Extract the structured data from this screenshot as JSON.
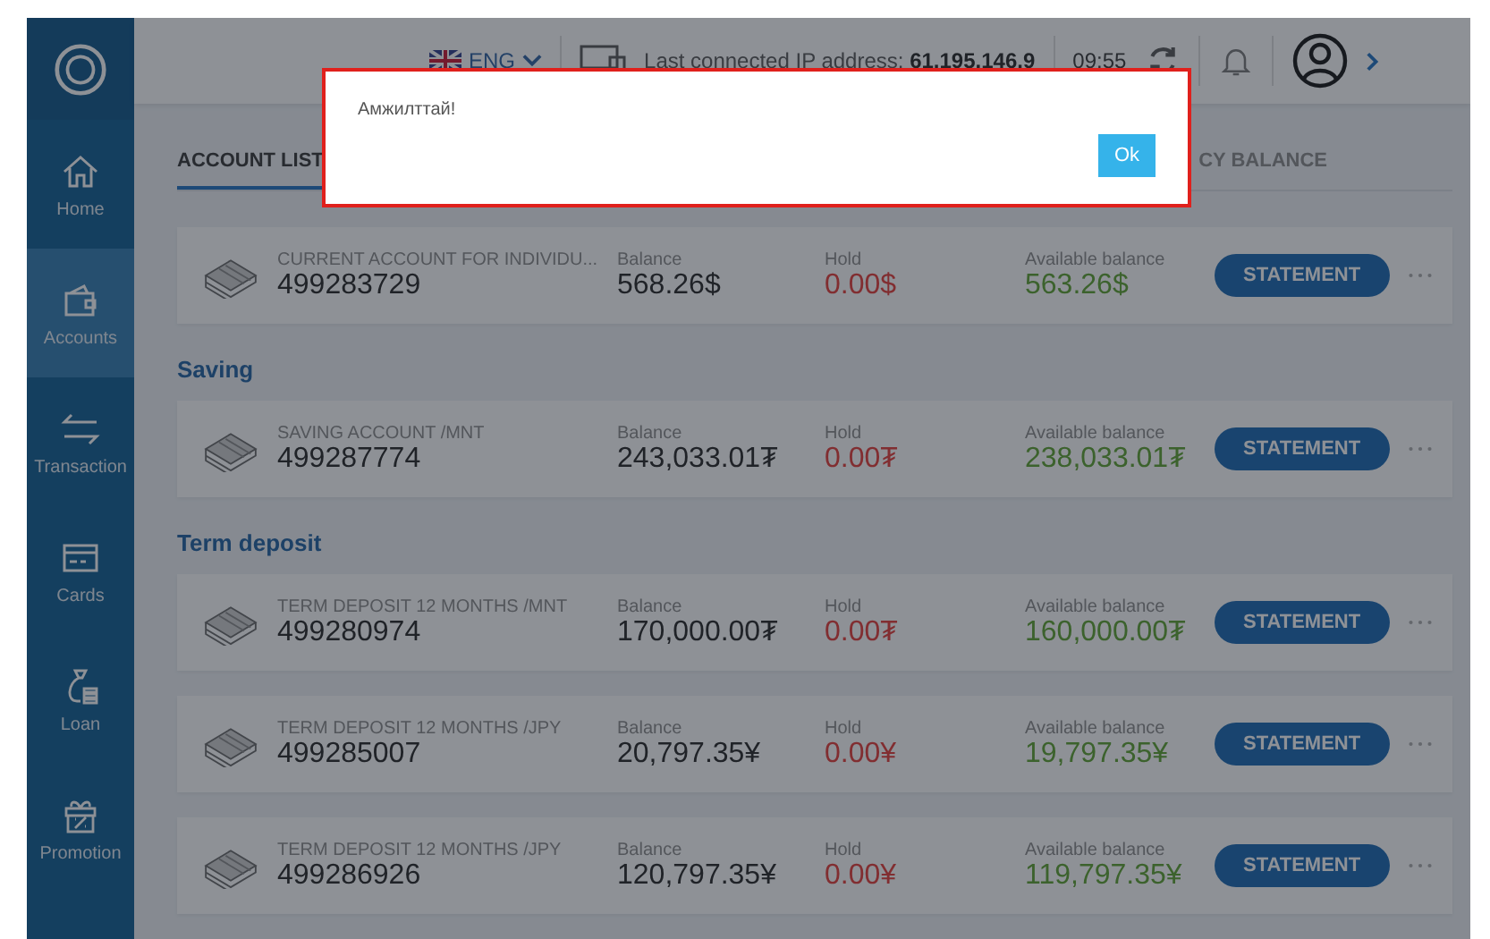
{
  "header": {
    "language": "ENG",
    "ip_label": "Last connected IP address:",
    "ip": "61.195.146.9",
    "time": "09:55"
  },
  "sidebar": {
    "items": [
      {
        "label": "Home",
        "selected": false
      },
      {
        "label": "Accounts",
        "selected": true
      },
      {
        "label": "Transaction",
        "selected": false
      },
      {
        "label": "Cards",
        "selected": false
      },
      {
        "label": "Loan",
        "selected": false
      },
      {
        "label": "Promotion",
        "selected": false
      }
    ]
  },
  "tabs": [
    {
      "label": "ACCOUNT LIST",
      "selected": true
    },
    {
      "label": "CY BALANCE",
      "selected": false
    }
  ],
  "groups": [
    {
      "accounts": [
        {
          "name": "CURRENT ACCOUNT FOR INDIVIDU...",
          "number": "499283729",
          "balance_label": "Balance",
          "balance": "568.26$",
          "hold_label": "Hold",
          "hold": "0.00$",
          "available_label": "Available balance",
          "available": "563.26$",
          "button": "STATEMENT"
        }
      ]
    },
    {
      "heading": "Saving",
      "accounts": [
        {
          "name": "SAVING ACCOUNT /MNT",
          "number": "499287774",
          "balance_label": "Balance",
          "balance": "243,033.01₮",
          "hold_label": "Hold",
          "hold": "0.00₮",
          "available_label": "Available balance",
          "available": "238,033.01₮",
          "button": "STATEMENT"
        }
      ]
    },
    {
      "heading": "Term deposit",
      "accounts": [
        {
          "name": "TERM DEPOSIT 12 MONTHS /MNT",
          "number": "499280974",
          "balance_label": "Balance",
          "balance": "170,000.00₮",
          "hold_label": "Hold",
          "hold": "0.00₮",
          "available_label": "Available balance",
          "available": "160,000.00₮",
          "button": "STATEMENT"
        },
        {
          "name": "TERM DEPOSIT 12 MONTHS /JPY",
          "number": "499285007",
          "balance_label": "Balance",
          "balance": "20,797.35¥",
          "hold_label": "Hold",
          "hold": "0.00¥",
          "available_label": "Available balance",
          "available": "19,797.35¥",
          "button": "STATEMENT"
        },
        {
          "name": "TERM DEPOSIT 12 MONTHS /JPY",
          "number": "499286926",
          "balance_label": "Balance",
          "balance": "120,797.35¥",
          "hold_label": "Hold",
          "hold": "0.00¥",
          "available_label": "Available balance",
          "available": "119,797.35¥",
          "button": "STATEMENT"
        }
      ]
    }
  ],
  "dialog": {
    "message": "Амжилттай!",
    "button": "Ok"
  }
}
